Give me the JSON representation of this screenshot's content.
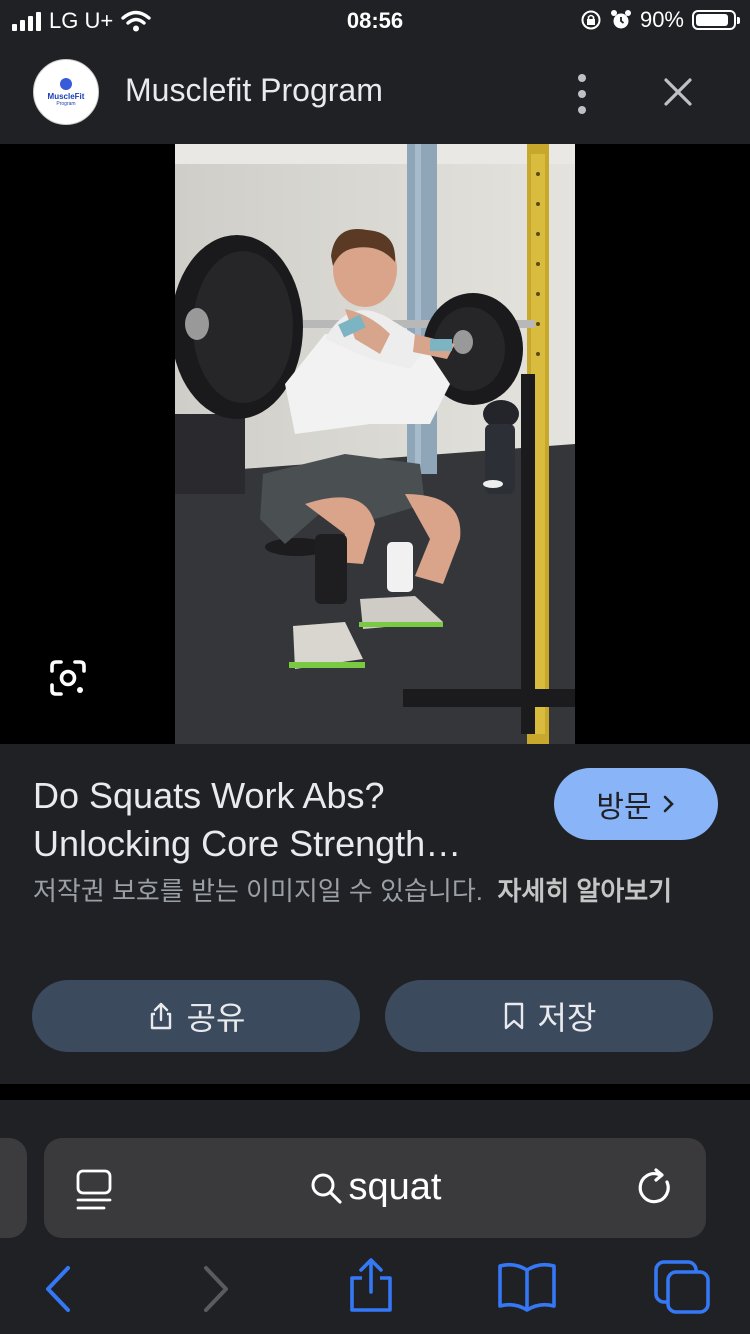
{
  "status_bar": {
    "carrier": "LG U+",
    "time": "08:56",
    "battery": "90%",
    "battery_level": 0.9
  },
  "header": {
    "site_title": "Musclefit Program",
    "logo_text": "MuscleFit",
    "logo_subtext": "Program"
  },
  "result": {
    "title": "Do Squats Work Abs? Unlocking Core Strength…",
    "visit_label": "방문",
    "copyright_notice": "저작권 보호를 받는 이미지일 수 있습니다.",
    "learn_more": "자세히 알아보기",
    "share_label": "공유",
    "save_label": "저장"
  },
  "browser": {
    "search_query": "squat"
  },
  "colors": {
    "background": "#202124",
    "accent_button": "#8ab4f8",
    "secondary_button": "#3c4a5e",
    "toolbar_icon": "#3478f6"
  }
}
